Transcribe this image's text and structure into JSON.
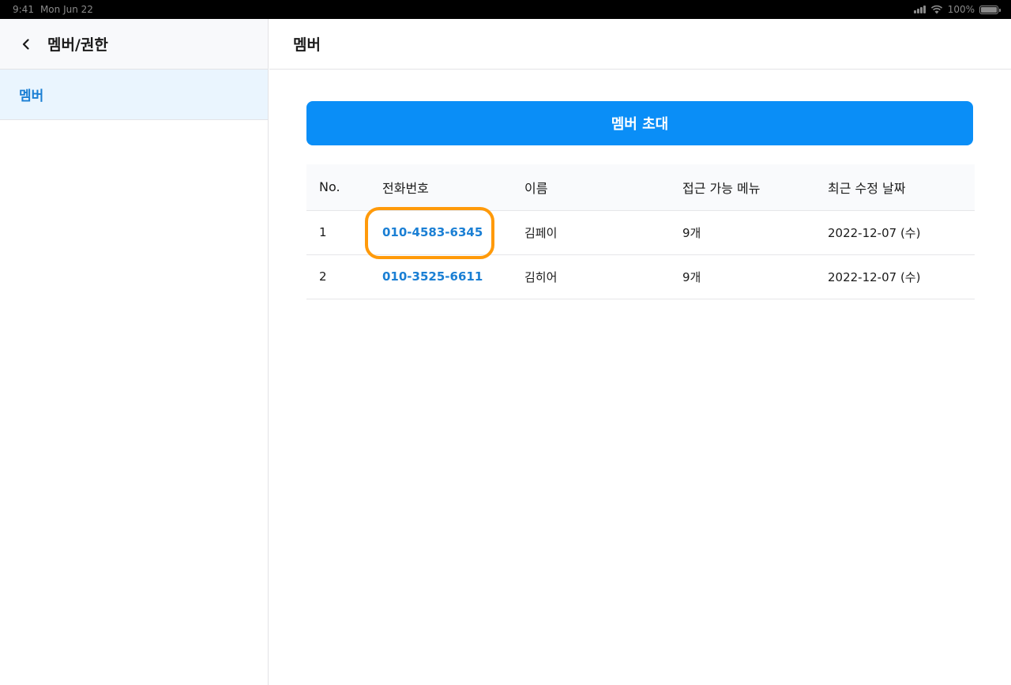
{
  "status_bar": {
    "time": "9:41",
    "date": "Mon Jun 22",
    "battery": "100%"
  },
  "sidebar": {
    "title": "멤버/권한",
    "items": [
      {
        "label": "멤버",
        "selected": true
      }
    ]
  },
  "main": {
    "title": "멤버",
    "invite_button_label": "멤버 초대",
    "table": {
      "headers": [
        "No.",
        "전화번호",
        "이름",
        "접근 가능 메뉴",
        "최근 수정 날짜"
      ],
      "rows": [
        {
          "no": "1",
          "phone": "010-4583-6345",
          "name": "김페이",
          "menu": "9개",
          "date": "2022-12-07 (수)"
        },
        {
          "no": "2",
          "phone": "010-3525-6611",
          "name": "김히어",
          "menu": "9개",
          "date": "2022-12-07 (수)"
        }
      ]
    }
  },
  "colors": {
    "accent": "#0a8ef7",
    "link": "#1a7fd4",
    "selected_bg": "#eaf5fe",
    "highlight": "#ff9a0a"
  }
}
